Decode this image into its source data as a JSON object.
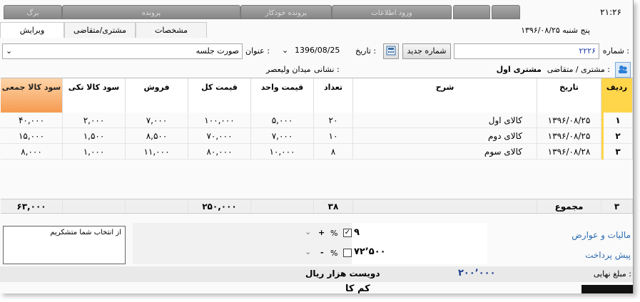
{
  "window": {
    "time": "۲۱:۲۶",
    "date_line": "پنج شنبه ۱۳۹۶/۰۸/۲۵"
  },
  "top_tabs": [
    "برگ",
    "پرونده",
    "پرونده خودکار",
    "ورود اطلاعات",
    "",
    ""
  ],
  "sub_tabs": [
    "ویرایش",
    "مشتری/متقاضی",
    "مشخصات"
  ],
  "header": {
    "number_label": "شماره :",
    "number_value": "۲۲۲۶",
    "new_number_button": "شماره جدید",
    "date_label": "تاریخ :",
    "date_value": "1396/08/25",
    "title_label": "عنوان :",
    "title_value": "صورت جلسه",
    "customer_label": "مشتری / متقاضی :",
    "customer_value": "مشتری اول",
    "address_label": "نشانی :",
    "address_value": "میدان ولیعصر"
  },
  "table": {
    "columns": [
      "ردیف",
      "تاریخ",
      "شرح",
      "تعداد",
      "قیمت واحد",
      "قیمت کل",
      "فروش",
      "سود کالا تکی",
      "سود کالا جمعی"
    ],
    "rows": [
      {
        "row": "۱",
        "date": "۱۳۹۶/۰۸/۲۵",
        "desc": "کالای اول",
        "qty": "۲۰",
        "unit": "۵,۰۰۰",
        "total": "۱۰۰,۰۰۰",
        "sale": "۷,۰۰۰",
        "single": "۲,۰۰۰",
        "group": "۴۰,۰۰۰"
      },
      {
        "row": "۲",
        "date": "۱۳۹۶/۰۸/۲۵",
        "desc": "کالای دوم",
        "qty": "۱۰",
        "unit": "۷,۰۰۰",
        "total": "۷۰,۰۰۰",
        "sale": "۸,۵۰۰",
        "single": "۱,۵۰۰",
        "group": "۱۵,۰۰۰"
      },
      {
        "row": "۳",
        "date": "۱۳۹۶/۰۸/۲۸",
        "desc": "کالای سوم",
        "qty": "۸",
        "unit": "۱۰,۰۰۰",
        "total": "۸۰,۰۰۰",
        "sale": "۱۱,۰۰۰",
        "single": "۱,۰۰۰",
        "group": "۸,۰۰۰"
      }
    ],
    "totals": {
      "row": "۳",
      "label": "مجموع",
      "qty": "۳۸",
      "total": "۲۵۰,۰۰۰",
      "group": "۶۳,۰۰۰"
    }
  },
  "footer": {
    "note": "از انتخاب شما متشکریم",
    "tax_link": "مالیات و عوارض",
    "prepay_link": "پیش پرداخت",
    "tax_value": "۹",
    "prepay_value": "۷۲٬۵۰۰",
    "percent": "%",
    "plus": "+",
    "minus": "-",
    "final_label": "مبلغ نهایی :",
    "final_value": "۲۰۰٬۰۰۰",
    "final_words": "دویست  هزار  ریال",
    "partial_text": "کم کا"
  }
}
